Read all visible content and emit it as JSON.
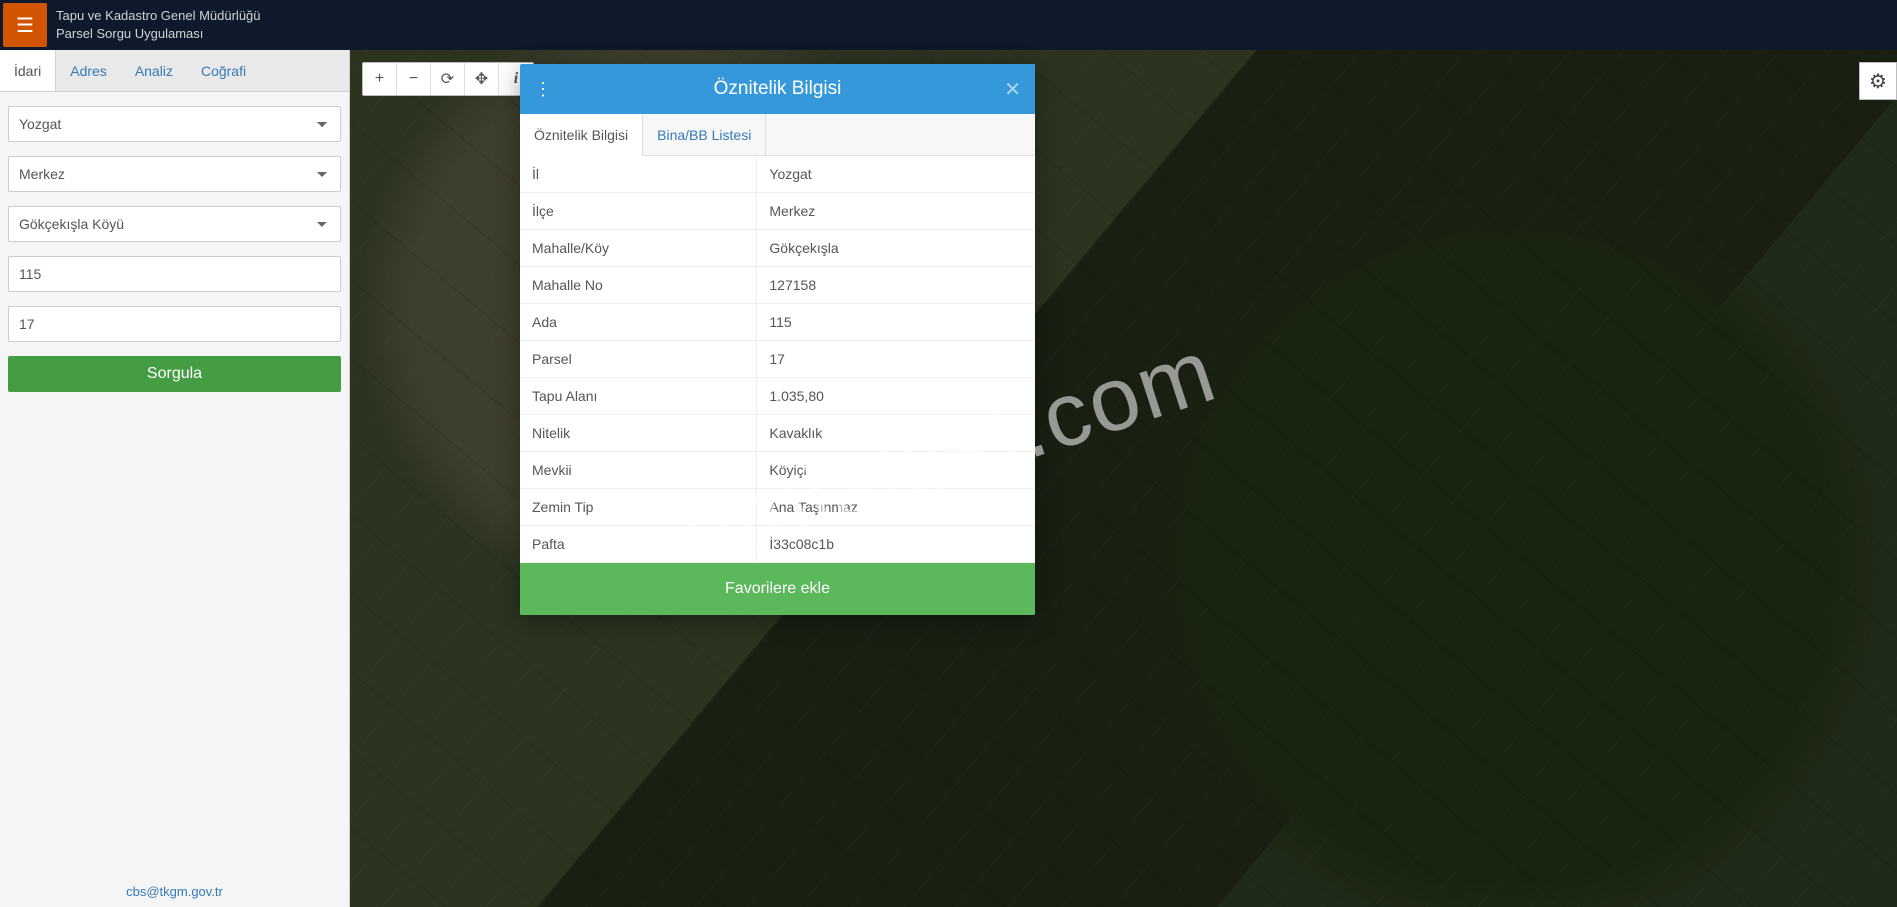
{
  "header": {
    "org": "Tapu ve Kadastro Genel Müdürlüğü",
    "app": "Parsel Sorgu Uygulaması"
  },
  "sidebar": {
    "tabs": [
      "İdari",
      "Adres",
      "Analiz",
      "Coğrafi"
    ],
    "active_tab": 0,
    "province": "Yozgat",
    "district": "Merkez",
    "village": "Gökçekışla Köyü",
    "block": "115",
    "parcel": "17",
    "query_label": "Sorgula",
    "footer": "cbs@tkgm.gov.tr"
  },
  "map_tools": {
    "zoom_in": "+",
    "zoom_out": "−",
    "refresh": "⟳",
    "locate": "✥",
    "info": "i",
    "settings": "⚙"
  },
  "modal": {
    "title": "Öznitelik Bilgisi",
    "tabs": [
      "Öznitelik Bilgisi",
      "Bina/BB Listesi"
    ],
    "active_tab": 0,
    "rows": [
      {
        "k": "İl",
        "v": "Yozgat"
      },
      {
        "k": "İlçe",
        "v": "Merkez"
      },
      {
        "k": "Mahalle/Köy",
        "v": "Gökçekışla"
      },
      {
        "k": "Mahalle No",
        "v": "127158"
      },
      {
        "k": "Ada",
        "v": "115"
      },
      {
        "k": "Parsel",
        "v": "17"
      },
      {
        "k": "Tapu Alanı",
        "v": "1.035,80"
      },
      {
        "k": "Nitelik",
        "v": "Kavaklık"
      },
      {
        "k": "Mevkii",
        "v": "Köyiçi"
      },
      {
        "k": "Zemin Tip",
        "v": "Ana Taşınmaz"
      },
      {
        "k": "Pafta",
        "v": "İ33c08c1b"
      }
    ],
    "favorite_label": "Favorilere ekle"
  },
  "watermark": "emlakjet.com"
}
